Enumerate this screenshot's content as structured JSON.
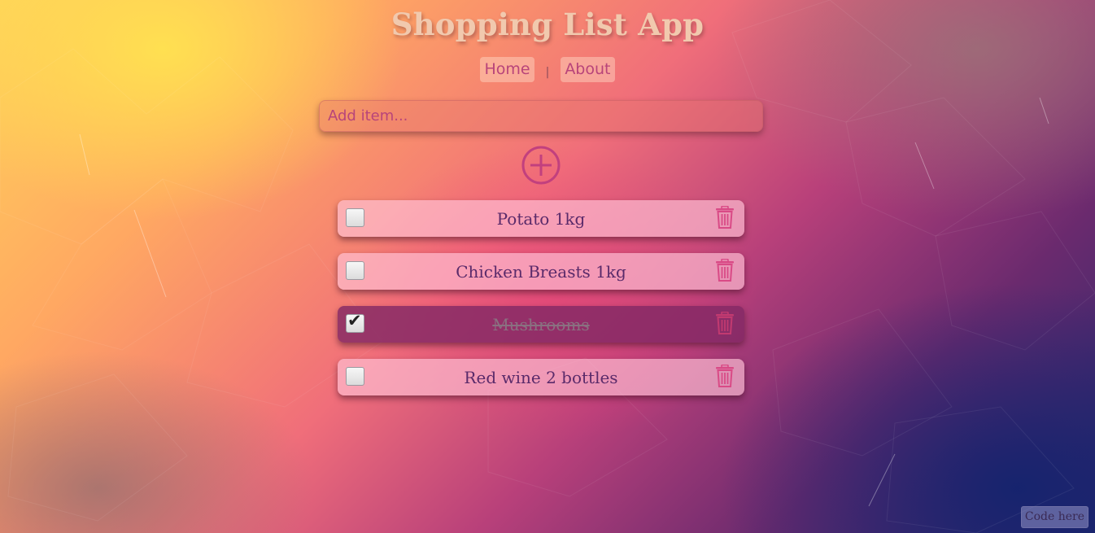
{
  "app": {
    "title": "Shopping List App"
  },
  "nav": {
    "items": [
      {
        "label": "Home"
      },
      {
        "label": "About"
      }
    ],
    "separator": "|"
  },
  "add_item": {
    "placeholder": "Add item...",
    "value": "",
    "button_icon": "plus-circle-icon"
  },
  "list": {
    "items": [
      {
        "label": "Potato 1kg",
        "checked": false
      },
      {
        "label": "Chicken Breasts 1kg",
        "checked": false
      },
      {
        "label": "Mushrooms",
        "checked": true
      },
      {
        "label": "Red wine 2 bottles",
        "checked": false
      }
    ],
    "delete_icon": "trash-icon",
    "check_glyph": "✔"
  },
  "footer": {
    "code_link": "Code here"
  },
  "colors": {
    "accent": "#b8447a",
    "title": "#f1c9ae",
    "item_text": "#5a2a6a",
    "done_bg": "#822864"
  }
}
